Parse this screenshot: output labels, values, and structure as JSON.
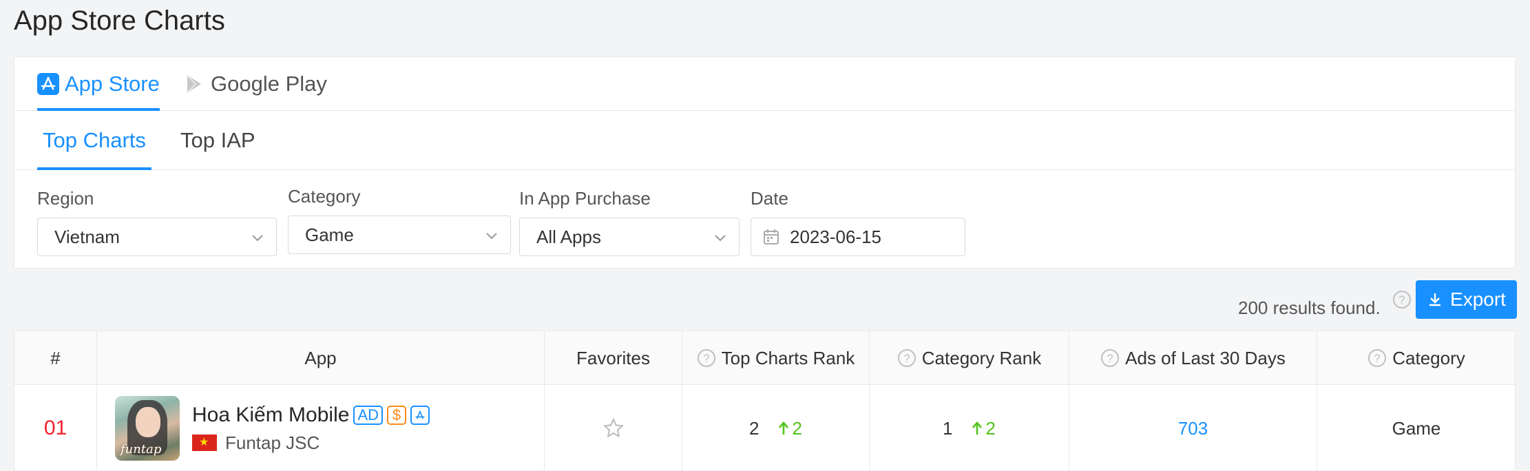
{
  "page": {
    "title": "App Store Charts"
  },
  "store_tabs": [
    {
      "label": "App Store",
      "icon": "app-store-icon",
      "active": true
    },
    {
      "label": "Google Play",
      "icon": "google-play-icon",
      "active": false
    }
  ],
  "chart_tabs": [
    {
      "label": "Top Charts",
      "active": true
    },
    {
      "label": "Top IAP",
      "active": false
    }
  ],
  "filters": {
    "region": {
      "label": "Region",
      "value": "Vietnam"
    },
    "category": {
      "label": "Category",
      "value": "Game"
    },
    "iap": {
      "label": "In App Purchase",
      "value": "All Apps"
    },
    "date": {
      "label": "Date",
      "value": "2023-06-15"
    }
  },
  "results": {
    "text": "200 results found.",
    "export_label": "Export"
  },
  "table": {
    "headers": {
      "rank": "#",
      "app": "App",
      "favorites": "Favorites",
      "top_charts_rank": "Top Charts Rank",
      "category_rank": "Category Rank",
      "ads": "Ads of Last 30 Days",
      "category": "Category"
    },
    "rows": [
      {
        "rank": "01",
        "app_name": "Hoa Kiếm Mobile",
        "badge_ad": "AD",
        "badge_iap": "$",
        "developer": "Funtap JSC",
        "icon_text": "funtap",
        "top_charts_rank": "2",
        "top_charts_change": "2",
        "category_rank": "1",
        "category_change": "2",
        "ads_last_30_days": "703",
        "category": "Game"
      }
    ]
  },
  "colors": {
    "accent": "#1890ff",
    "rank": "#f5222d",
    "up": "#52c41a"
  }
}
